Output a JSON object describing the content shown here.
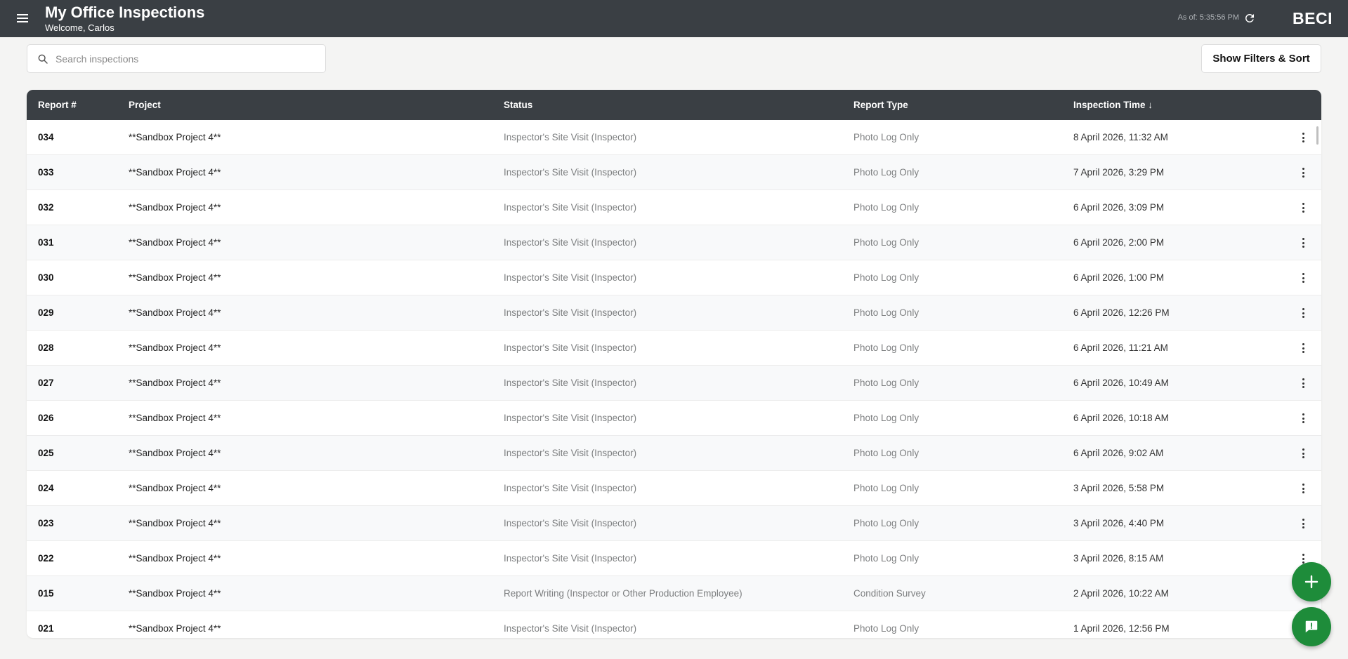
{
  "header": {
    "title": "My Office Inspections",
    "welcome": "Welcome, Carlos",
    "as_of": "As of: 5:35:56 PM",
    "brand": "BECI",
    "bg_color": "#3a3f44"
  },
  "search": {
    "placeholder": "Search inspections",
    "value": ""
  },
  "filters_button": "Show Filters & Sort",
  "table": {
    "columns": [
      "Report #",
      "Project",
      "Status",
      "Report Type",
      "Inspection Time ↓"
    ],
    "rows": [
      {
        "report": "034",
        "project": "**Sandbox Project 4**",
        "status": "Inspector's Site Visit (Inspector)",
        "type": "Photo Log Only",
        "time": "8 April 2026, 11:32 AM"
      },
      {
        "report": "033",
        "project": "**Sandbox Project 4**",
        "status": "Inspector's Site Visit (Inspector)",
        "type": "Photo Log Only",
        "time": "7 April 2026, 3:29 PM"
      },
      {
        "report": "032",
        "project": "**Sandbox Project 4**",
        "status": "Inspector's Site Visit (Inspector)",
        "type": "Photo Log Only",
        "time": "6 April 2026, 3:09 PM"
      },
      {
        "report": "031",
        "project": "**Sandbox Project 4**",
        "status": "Inspector's Site Visit (Inspector)",
        "type": "Photo Log Only",
        "time": "6 April 2026, 2:00 PM"
      },
      {
        "report": "030",
        "project": "**Sandbox Project 4**",
        "status": "Inspector's Site Visit (Inspector)",
        "type": "Photo Log Only",
        "time": "6 April 2026, 1:00 PM"
      },
      {
        "report": "029",
        "project": "**Sandbox Project 4**",
        "status": "Inspector's Site Visit (Inspector)",
        "type": "Photo Log Only",
        "time": "6 April 2026, 12:26 PM"
      },
      {
        "report": "028",
        "project": "**Sandbox Project 4**",
        "status": "Inspector's Site Visit (Inspector)",
        "type": "Photo Log Only",
        "time": "6 April 2026, 11:21 AM"
      },
      {
        "report": "027",
        "project": "**Sandbox Project 4**",
        "status": "Inspector's Site Visit (Inspector)",
        "type": "Photo Log Only",
        "time": "6 April 2026, 10:49 AM"
      },
      {
        "report": "026",
        "project": "**Sandbox Project 4**",
        "status": "Inspector's Site Visit (Inspector)",
        "type": "Photo Log Only",
        "time": "6 April 2026, 10:18 AM"
      },
      {
        "report": "025",
        "project": "**Sandbox Project 4**",
        "status": "Inspector's Site Visit (Inspector)",
        "type": "Photo Log Only",
        "time": "6 April 2026, 9:02 AM"
      },
      {
        "report": "024",
        "project": "**Sandbox Project 4**",
        "status": "Inspector's Site Visit (Inspector)",
        "type": "Photo Log Only",
        "time": "3 April 2026, 5:58 PM"
      },
      {
        "report": "023",
        "project": "**Sandbox Project 4**",
        "status": "Inspector's Site Visit (Inspector)",
        "type": "Photo Log Only",
        "time": "3 April 2026, 4:40 PM"
      },
      {
        "report": "022",
        "project": "**Sandbox Project 4**",
        "status": "Inspector's Site Visit (Inspector)",
        "type": "Photo Log Only",
        "time": "3 April 2026, 8:15 AM"
      },
      {
        "report": "015",
        "project": "**Sandbox Project 4**",
        "status": "Report Writing (Inspector or Other Production Employee)",
        "type": "Condition Survey",
        "time": "2 April 2026, 10:22 AM"
      },
      {
        "report": "021",
        "project": "**Sandbox Project 4**",
        "status": "Inspector's Site Visit (Inspector)",
        "type": "Photo Log Only",
        "time": "1 April 2026, 12:56 PM"
      }
    ]
  },
  "icons": {
    "menu": "hamburger-menu-icon",
    "refresh": "refresh-icon",
    "search": "search-icon",
    "row_actions": "kebab-menu-icon",
    "add": "plus-icon",
    "feedback": "chat-feedback-icon"
  },
  "fab_color": "#1e8c3a"
}
